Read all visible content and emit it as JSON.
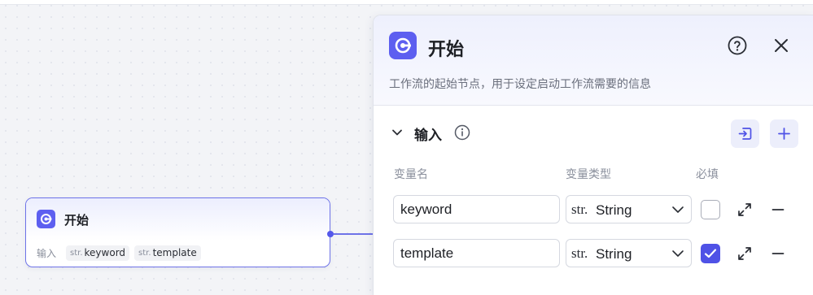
{
  "canvas_node": {
    "title": "开始",
    "input_label": "输入",
    "params": [
      {
        "type": "str.",
        "name": "keyword"
      },
      {
        "type": "str.",
        "name": "template"
      }
    ]
  },
  "panel": {
    "title": "开始",
    "description": "工作流的起始节点，用于设定启动工作流需要的信息",
    "section_title": "输入",
    "columns": {
      "name": "变量名",
      "type": "变量类型",
      "required": "必填"
    },
    "rows": [
      {
        "name": "keyword",
        "type_prefix": "str.",
        "type": "String",
        "required": false
      },
      {
        "name": "template",
        "type_prefix": "str.",
        "type": "String",
        "required": true
      }
    ]
  },
  "colors": {
    "accent": "#5d5ff0",
    "border_active": "#6e73e8"
  },
  "icons": [
    "start-node-icon",
    "help-icon",
    "close-icon",
    "chevron-down-icon",
    "info-icon",
    "import-icon",
    "plus-icon",
    "expand-icon",
    "minus-icon",
    "check-icon"
  ]
}
